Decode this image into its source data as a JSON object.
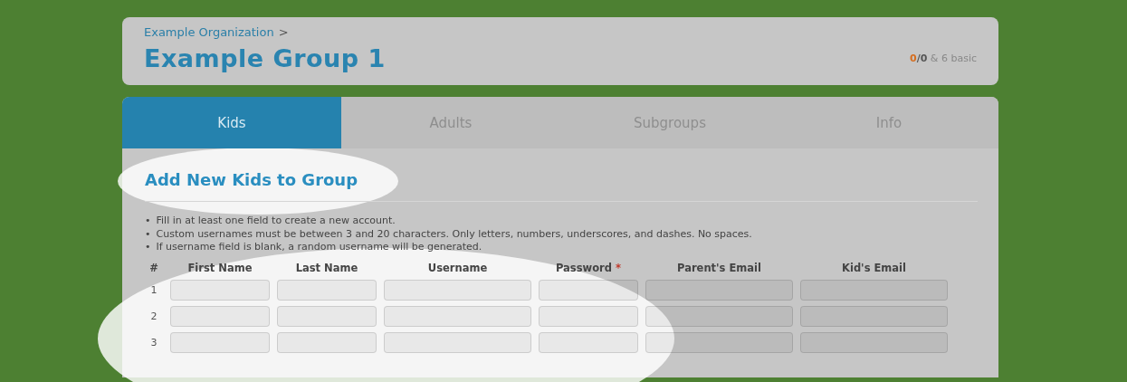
{
  "breadcrumb": {
    "link": "Example Organization",
    "separator": ">"
  },
  "group_title": "Example Group 1",
  "quota": {
    "used": "0",
    "slash": "/",
    "total": "0",
    "rest": "& 6 basic"
  },
  "tabs": [
    {
      "label": "Kids",
      "selected": true
    },
    {
      "label": "Adults",
      "selected": false
    },
    {
      "label": "Subgroups",
      "selected": false
    },
    {
      "label": "Info",
      "selected": false
    }
  ],
  "section_title": "Add New Kids to Group",
  "bullet": "•",
  "notes": [
    "Fill in at least one field to create a new account.",
    "Custom usernames must be between 3 and 20 characters. Only letters, numbers, underscores, and dashes. No spaces.",
    "If username field is blank, a random username will be generated."
  ],
  "table": {
    "number_header": "#",
    "columns": [
      {
        "label": "First Name",
        "required": false
      },
      {
        "label": "Last Name",
        "required": false
      },
      {
        "label": "Username",
        "required": false
      },
      {
        "label": "Password",
        "required": true
      },
      {
        "label": "Parent's Email",
        "required": false
      },
      {
        "label": "Kid's Email",
        "required": false
      }
    ],
    "required_mark": "*",
    "rows": [
      "1",
      "2",
      "3"
    ]
  }
}
